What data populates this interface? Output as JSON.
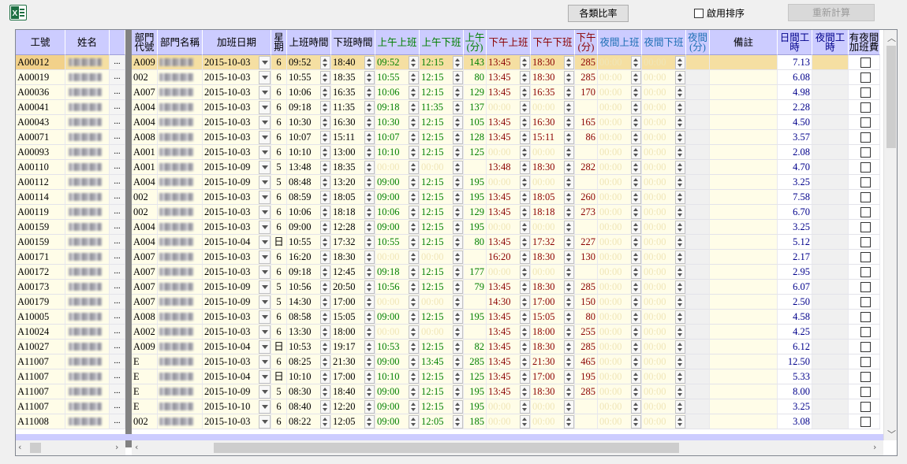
{
  "toolbar": {
    "excel_icon": "excel-icon",
    "ratio_label": "各類比率",
    "sort_label": "啟用排序",
    "recalc_label": "重新計算"
  },
  "headers": {
    "emp_id": "工號",
    "name": "姓名",
    "dept_code": "部門\n代號",
    "dept_name": "部門名稱",
    "ot_date": "加班日期",
    "weekday": "星\n期",
    "start": "上班時間",
    "end": "下班時間",
    "am_in": "上午上班",
    "am_out": "上午下班",
    "am_min": "上午\n(分)",
    "pm_in": "下午上班",
    "pm_out": "下午下班",
    "pm_min": "下午\n(分)",
    "nt_in": "夜間上班",
    "nt_out": "夜間下班",
    "nt_min": "夜間\n(分)",
    "note": "備註",
    "day_hours": "日間工\n時",
    "night_hours": "夜間工\n時",
    "night_fee": "有夜間\n加班費"
  },
  "colors": {
    "am": "#008000",
    "pm": "#8b0000",
    "night": "#1e6fb5",
    "hours": "#00008b",
    "placeholder": "#f0e6b8"
  },
  "placeholder_time": "00:00",
  "more_button_label": "...",
  "rows": [
    [
      "A00012",
      "A009",
      "2015-10-03",
      "6",
      "09:52",
      "18:40",
      "09:52",
      "12:15",
      "143",
      "13:45",
      "18:30",
      "285",
      "7.13"
    ],
    [
      "A00019",
      "002",
      "2015-10-03",
      "6",
      "10:55",
      "18:35",
      "10:55",
      "12:15",
      "80",
      "13:45",
      "18:30",
      "285",
      "6.08"
    ],
    [
      "A00036",
      "A007",
      "2015-10-03",
      "6",
      "10:06",
      "16:35",
      "10:06",
      "12:15",
      "129",
      "13:45",
      "16:35",
      "170",
      "4.98"
    ],
    [
      "A00041",
      "A004",
      "2015-10-03",
      "6",
      "09:18",
      "11:35",
      "09:18",
      "11:35",
      "137",
      "",
      "",
      "",
      "2.28"
    ],
    [
      "A00043",
      "A004",
      "2015-10-03",
      "6",
      "10:30",
      "16:30",
      "10:30",
      "12:15",
      "105",
      "13:45",
      "16:30",
      "165",
      "4.50"
    ],
    [
      "A00071",
      "A008",
      "2015-10-03",
      "6",
      "10:07",
      "15:11",
      "10:07",
      "12:15",
      "128",
      "13:45",
      "15:11",
      "86",
      "3.57"
    ],
    [
      "A00093",
      "A001",
      "2015-10-03",
      "6",
      "10:10",
      "13:00",
      "10:10",
      "12:15",
      "125",
      "",
      "",
      "",
      "2.08"
    ],
    [
      "A00110",
      "A001",
      "2015-10-09",
      "5",
      "13:48",
      "18:35",
      "",
      "",
      "",
      "13:48",
      "18:30",
      "282",
      "4.70"
    ],
    [
      "A00112",
      "A004",
      "2015-10-09",
      "5",
      "08:48",
      "13:20",
      "09:00",
      "12:15",
      "195",
      "",
      "",
      "",
      "3.25"
    ],
    [
      "A00114",
      "002",
      "2015-10-03",
      "6",
      "08:59",
      "18:05",
      "09:00",
      "12:15",
      "195",
      "13:45",
      "18:05",
      "260",
      "7.58"
    ],
    [
      "A00119",
      "002",
      "2015-10-03",
      "6",
      "10:06",
      "18:18",
      "10:06",
      "12:15",
      "129",
      "13:45",
      "18:18",
      "273",
      "6.70"
    ],
    [
      "A00159",
      "A004",
      "2015-10-03",
      "6",
      "09:00",
      "12:28",
      "09:00",
      "12:15",
      "195",
      "",
      "",
      "",
      "3.25"
    ],
    [
      "A00159",
      "A004",
      "2015-10-04",
      "日",
      "10:55",
      "17:32",
      "10:55",
      "12:15",
      "80",
      "13:45",
      "17:32",
      "227",
      "5.12"
    ],
    [
      "A00171",
      "A007",
      "2015-10-03",
      "6",
      "16:20",
      "18:30",
      "",
      "",
      "",
      "16:20",
      "18:30",
      "130",
      "2.17"
    ],
    [
      "A00172",
      "A007",
      "2015-10-03",
      "6",
      "09:18",
      "12:45",
      "09:18",
      "12:15",
      "177",
      "",
      "",
      "",
      "2.95"
    ],
    [
      "A00173",
      "A007",
      "2015-10-09",
      "5",
      "10:56",
      "20:50",
      "10:56",
      "12:15",
      "79",
      "13:45",
      "18:30",
      "285",
      "6.07"
    ],
    [
      "A00179",
      "A007",
      "2015-10-09",
      "5",
      "14:30",
      "17:00",
      "",
      "",
      "",
      "14:30",
      "17:00",
      "150",
      "2.50"
    ],
    [
      "A10005",
      "A008",
      "2015-10-03",
      "6",
      "08:58",
      "15:05",
      "09:00",
      "12:15",
      "195",
      "13:45",
      "15:05",
      "80",
      "4.58"
    ],
    [
      "A10024",
      "A002",
      "2015-10-03",
      "6",
      "13:30",
      "18:00",
      "",
      "",
      "",
      "13:45",
      "18:00",
      "255",
      "4.25"
    ],
    [
      "A10027",
      "A009",
      "2015-10-04",
      "日",
      "10:53",
      "19:17",
      "10:53",
      "12:15",
      "82",
      "13:45",
      "18:30",
      "285",
      "6.12"
    ],
    [
      "A11007",
      "E",
      "2015-10-03",
      "6",
      "08:25",
      "21:30",
      "09:00",
      "13:45",
      "285",
      "13:45",
      "21:30",
      "465",
      "12.50"
    ],
    [
      "A11007",
      "E",
      "2015-10-04",
      "日",
      "10:10",
      "17:00",
      "10:10",
      "12:15",
      "125",
      "13:45",
      "17:00",
      "195",
      "5.33"
    ],
    [
      "A11007",
      "E",
      "2015-10-09",
      "5",
      "08:30",
      "18:40",
      "09:00",
      "12:15",
      "195",
      "13:45",
      "18:30",
      "285",
      "8.00"
    ],
    [
      "A11007",
      "E",
      "2015-10-10",
      "6",
      "08:40",
      "12:20",
      "09:00",
      "12:15",
      "195",
      "",
      "",
      "",
      "3.25"
    ],
    [
      "A11008",
      "002",
      "2015-10-03",
      "6",
      "08:22",
      "12:05",
      "09:00",
      "12:05",
      "185",
      "",
      "",
      "",
      "3.08"
    ]
  ]
}
